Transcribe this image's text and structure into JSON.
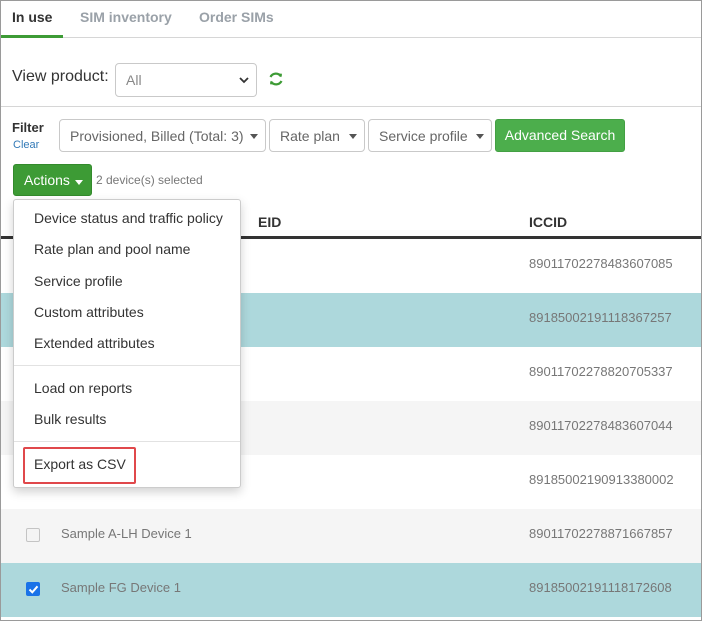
{
  "tabs": [
    {
      "label": "In use",
      "active": true
    },
    {
      "label": "SIM inventory",
      "active": false
    },
    {
      "label": "Order SIMs",
      "active": false
    }
  ],
  "view_product": {
    "label": "View product:",
    "selected": "All",
    "icon": "refresh-icon"
  },
  "filter": {
    "label": "Filter",
    "clear_label": "Clear",
    "status_dropdown": "Provisioned, Billed (Total: 3)",
    "rate_plan_dropdown": "Rate plan",
    "service_profile_dropdown": "Service profile",
    "advanced_search_label": "Advanced Search"
  },
  "actions": {
    "button_label": "Actions",
    "selected_text": "2 device(s) selected",
    "menu": {
      "group1": [
        "Device status and traffic policy",
        "Rate plan and pool name",
        "Service profile",
        "Custom attributes",
        "Extended attributes"
      ],
      "group2": [
        "Load on reports",
        "Bulk results"
      ],
      "group3": [
        "Export as CSV"
      ]
    }
  },
  "table": {
    "headers": {
      "eid": "EID",
      "iccid": "ICCID"
    },
    "rows": [
      {
        "name": "",
        "iccid": "89011702278483607085",
        "selected": false
      },
      {
        "name": "",
        "iccid": "89185002191118367257",
        "selected": true
      },
      {
        "name": "",
        "iccid": "89011702278820705337",
        "selected": false
      },
      {
        "name": "",
        "iccid": "89011702278483607044",
        "selected": false
      },
      {
        "name": "",
        "iccid": "89185002190913380002",
        "selected": false
      },
      {
        "name": "Sample A-LH Device 1",
        "iccid": "89011702278871667857",
        "selected": false
      },
      {
        "name": "Sample FG Device 1",
        "iccid": "89185002191118172608",
        "selected": true
      }
    ]
  },
  "colors": {
    "accent_green": "#3d9b35",
    "selected_row": "#add8dc",
    "highlight_red": "#e0484b",
    "link_blue": "#337ab7"
  }
}
